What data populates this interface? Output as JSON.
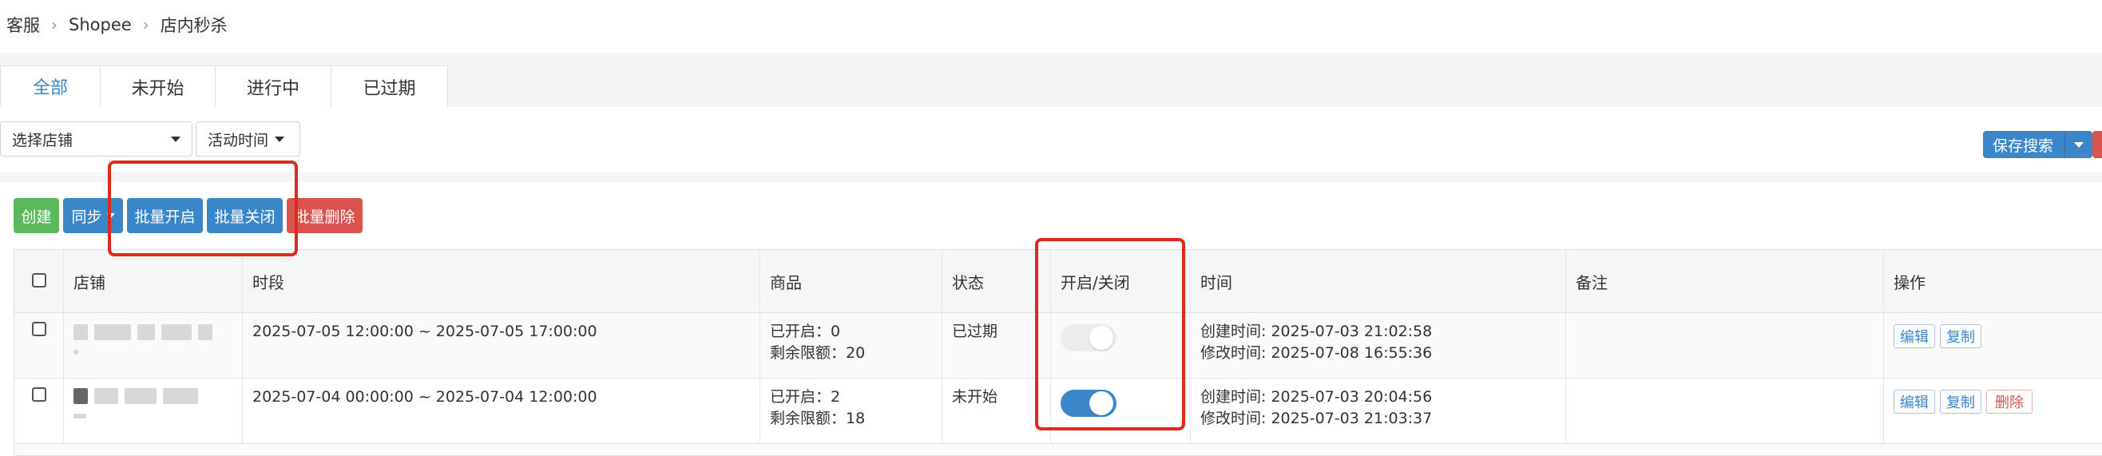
{
  "breadcrumb": {
    "items": [
      "客服",
      "Shopee",
      "店内秒杀"
    ]
  },
  "tabs": [
    {
      "label": "全部",
      "active": true
    },
    {
      "label": "未开始",
      "active": false
    },
    {
      "label": "进行中",
      "active": false
    },
    {
      "label": "已过期",
      "active": false
    }
  ],
  "filters": {
    "shop_select": "选择店铺",
    "time_select": "活动时间",
    "save_search": "保存搜索"
  },
  "toolbar": {
    "create": "创建",
    "sync": "同步",
    "batch_enable": "批量开启",
    "batch_disable": "批量关闭",
    "batch_delete": "批量删除"
  },
  "table": {
    "headers": [
      "店铺",
      "时段",
      "商品",
      "状态",
      "开启/关闭",
      "时间",
      "备注",
      "操作"
    ],
    "rows": [
      {
        "period": "2025-07-05 12:00:00 ~ 2025-07-05 17:00:00",
        "goods_enabled": "已开启：0",
        "goods_remaining": "剩余限额：20",
        "status": "已过期",
        "enabled": false,
        "created": "创建时间: 2025-07-03 21:02:58",
        "modified": "修改时间: 2025-07-08 16:55:36",
        "remark": "",
        "actions": [
          "编辑",
          "复制"
        ]
      },
      {
        "period": "2025-07-04 00:00:00 ~ 2025-07-04 12:00:00",
        "goods_enabled": "已开启：2",
        "goods_remaining": "剩余限额：18",
        "status": "未开始",
        "enabled": true,
        "created": "创建时间: 2025-07-03 20:04:56",
        "modified": "修改时间: 2025-07-03 21:03:37",
        "remark": "",
        "actions": [
          "编辑",
          "复制",
          "删除"
        ]
      }
    ]
  },
  "colors": {
    "primary": "#3a86c8",
    "success": "#5cb85c",
    "danger": "#d9534f",
    "highlight": "#e0281c"
  }
}
